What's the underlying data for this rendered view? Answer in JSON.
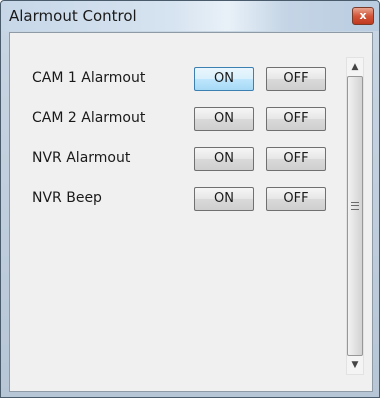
{
  "window": {
    "title": "Alarmout Control",
    "close_glyph": "x",
    "close_icon": "close-icon"
  },
  "rows": [
    {
      "label": "CAM 1 Alarmout",
      "on_label": "ON",
      "off_label": "OFF"
    },
    {
      "label": "CAM 2 Alarmout",
      "on_label": "ON",
      "off_label": "OFF"
    },
    {
      "label": "NVR Alarmout",
      "on_label": "ON",
      "off_label": "OFF"
    },
    {
      "label": "NVR Beep",
      "on_label": "ON",
      "off_label": "OFF"
    }
  ],
  "scrollbar": {
    "up_glyph": "▲",
    "down_glyph": "▼",
    "up_icon": "scroll-up-arrow-icon",
    "down_icon": "scroll-down-arrow-icon"
  },
  "colors": {
    "focus_border": "#3c7fb1",
    "close_button": "#c0391f"
  }
}
